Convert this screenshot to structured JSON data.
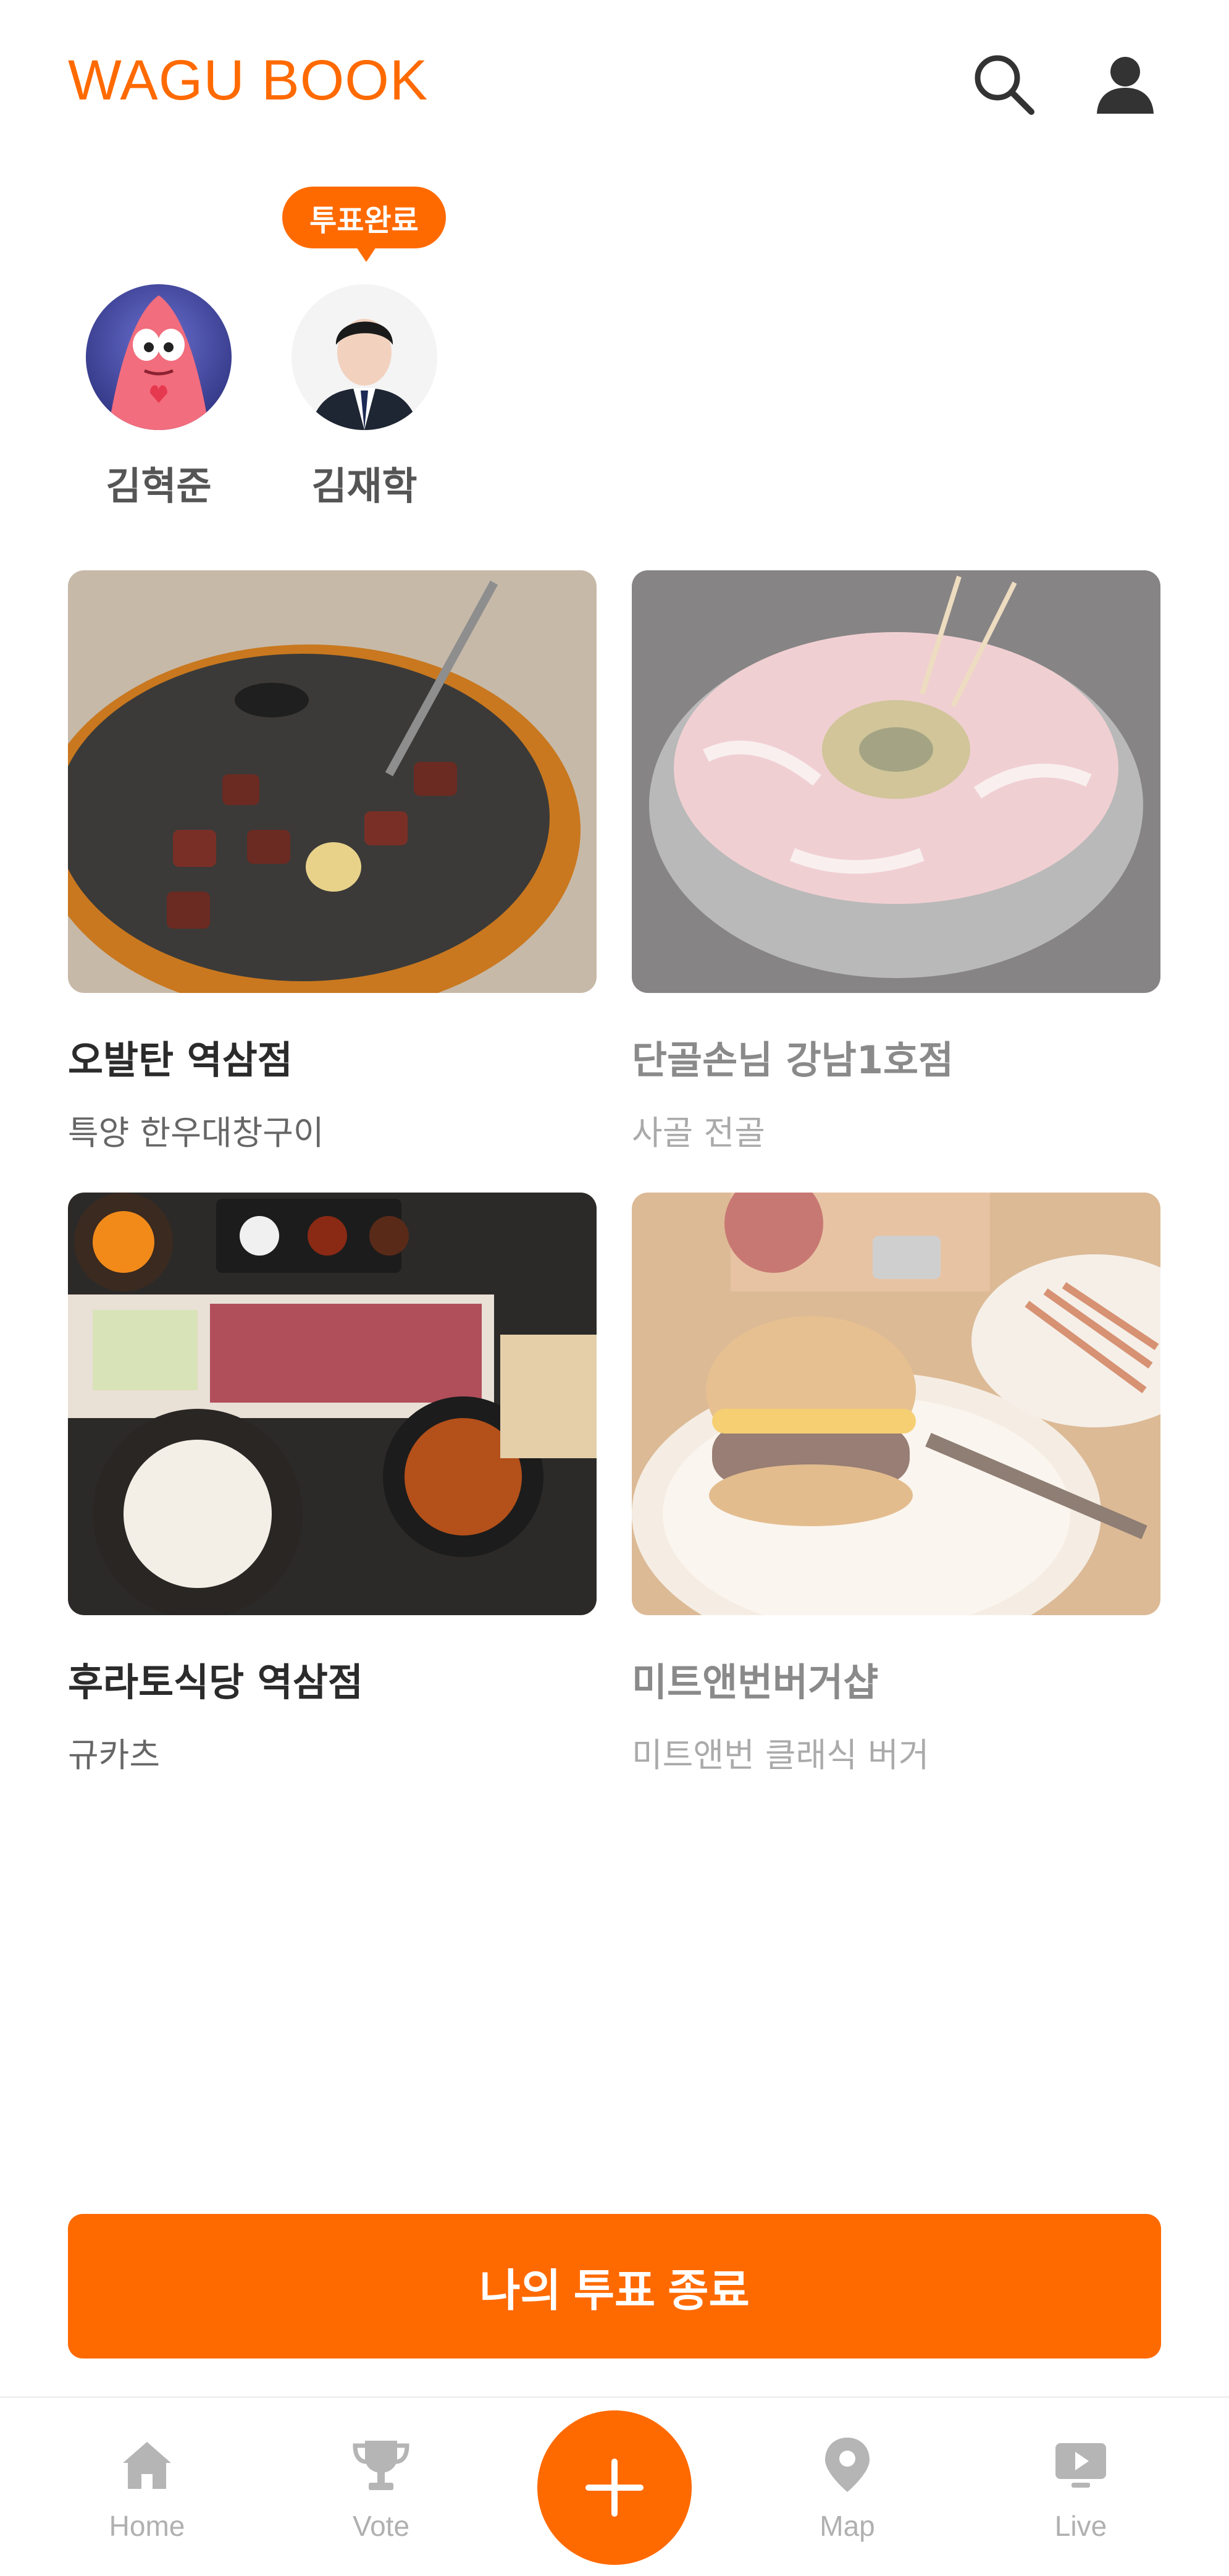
{
  "app": {
    "title": "WAGU BOOK",
    "accent_color": "#ff6a00"
  },
  "header": {
    "search_icon": "search-icon",
    "profile_icon": "user-icon"
  },
  "voters": [
    {
      "name": "김혁준",
      "badge": ""
    },
    {
      "name": "김재학",
      "badge": "투표완료"
    }
  ],
  "restaurants": [
    {
      "name": "오발탄 역삼점",
      "menu": "특양 한우대창구이",
      "dimmed": false
    },
    {
      "name": "단골손님 강남1호점",
      "menu": "사골 전골",
      "dimmed": true
    },
    {
      "name": "후라토식당 역삼점",
      "menu": "규카츠",
      "dimmed": false
    },
    {
      "name": "미트앤번버거샵",
      "menu": "미트앤번 클래식 버거",
      "dimmed": true
    }
  ],
  "actions": {
    "end_vote_label": "나의 투표 종료"
  },
  "bottom_nav": {
    "items": [
      {
        "label": "Home",
        "icon": "home-icon"
      },
      {
        "label": "Vote",
        "icon": "trophy-icon"
      },
      {
        "label": "",
        "icon": "plus-icon"
      },
      {
        "label": "Map",
        "icon": "map-pin-icon"
      },
      {
        "label": "Live",
        "icon": "live-icon"
      }
    ]
  }
}
